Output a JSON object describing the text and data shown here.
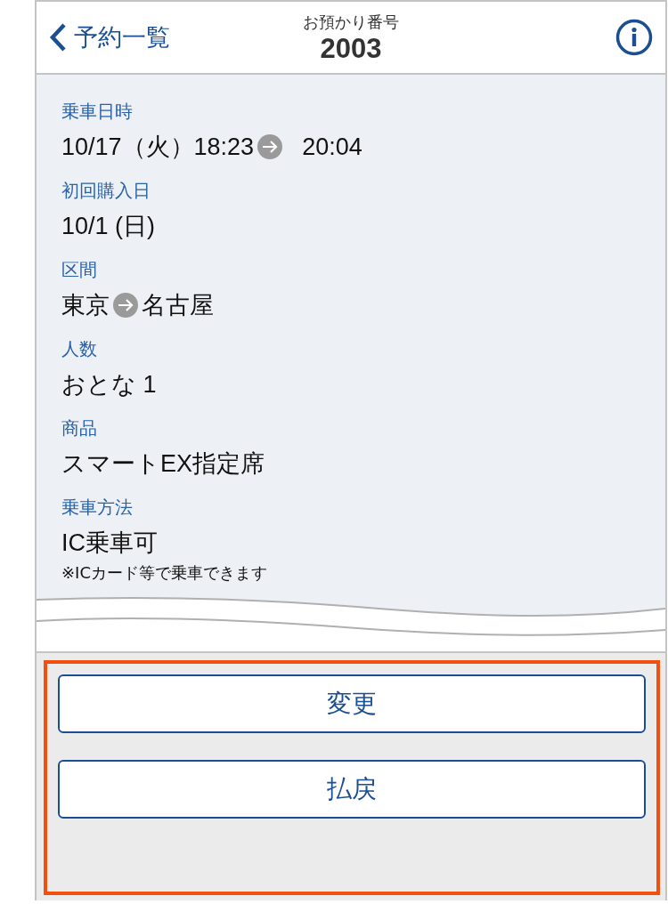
{
  "header": {
    "back_label": "予約一覧",
    "caption": "お預かり番号",
    "number": "2003"
  },
  "fields": [
    {
      "label": "乗車日時",
      "segments": [
        "10/17（火）18:23",
        "20:04"
      ]
    },
    {
      "label": "初回購入日",
      "segments": [
        "10/1 (日)"
      ]
    },
    {
      "label": "区間",
      "segments": [
        "東京",
        "名古屋"
      ]
    },
    {
      "label": "人数",
      "segments": [
        "おとな 1"
      ]
    },
    {
      "label": "商品",
      "segments": [
        "スマートEX指定席"
      ]
    },
    {
      "label": "乗車方法",
      "segments": [
        "IC乗車可"
      ],
      "note": "※ICカード等で乗車できます"
    }
  ],
  "buttons": [
    {
      "label": "変更"
    },
    {
      "label": "払戻"
    }
  ]
}
